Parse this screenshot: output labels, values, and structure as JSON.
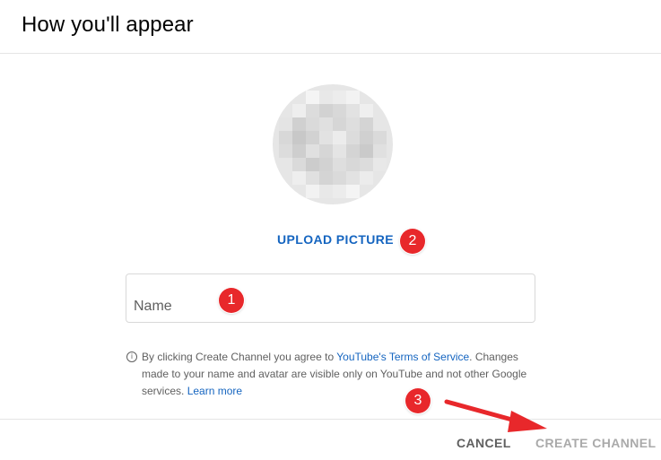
{
  "dialog": {
    "title": "How you'll appear"
  },
  "avatar": {
    "pixels": [
      {
        "c": "#f4f4f4",
        "r": 0,
        "col": 2
      },
      {
        "c": "#e8e8e8",
        "r": 0,
        "col": 3
      },
      {
        "c": "#ececec",
        "r": 0,
        "col": 4
      },
      {
        "c": "#f2f2f2",
        "r": 0,
        "col": 5
      },
      {
        "c": "#eeeeee",
        "r": 1,
        "col": 1
      },
      {
        "c": "#dcdcdc",
        "r": 1,
        "col": 2
      },
      {
        "c": "#d2d2d2",
        "r": 1,
        "col": 3
      },
      {
        "c": "#d8d8d8",
        "r": 1,
        "col": 4
      },
      {
        "c": "#e2e2e2",
        "r": 1,
        "col": 5
      },
      {
        "c": "#efefef",
        "r": 1,
        "col": 6
      },
      {
        "c": "#e4e4e4",
        "r": 2,
        "col": 0
      },
      {
        "c": "#d0d0d0",
        "r": 2,
        "col": 1
      },
      {
        "c": "#dadada",
        "r": 2,
        "col": 2
      },
      {
        "c": "#e0e0e0",
        "r": 2,
        "col": 3
      },
      {
        "c": "#d6d6d6",
        "r": 2,
        "col": 4
      },
      {
        "c": "#dedede",
        "r": 2,
        "col": 5
      },
      {
        "c": "#d4d4d4",
        "r": 2,
        "col": 6
      },
      {
        "c": "#e6e6e6",
        "r": 2,
        "col": 7
      },
      {
        "c": "#d8d8d8",
        "r": 3,
        "col": 0
      },
      {
        "c": "#c8c8c8",
        "r": 3,
        "col": 1
      },
      {
        "c": "#d2d2d2",
        "r": 3,
        "col": 2
      },
      {
        "c": "#e2e2e2",
        "r": 3,
        "col": 3
      },
      {
        "c": "#ececec",
        "r": 3,
        "col": 4
      },
      {
        "c": "#dcdcdc",
        "r": 3,
        "col": 5
      },
      {
        "c": "#d0d0d0",
        "r": 3,
        "col": 6
      },
      {
        "c": "#dadada",
        "r": 3,
        "col": 7
      },
      {
        "c": "#dcdcdc",
        "r": 4,
        "col": 0
      },
      {
        "c": "#cecece",
        "r": 4,
        "col": 1
      },
      {
        "c": "#e0e0e0",
        "r": 4,
        "col": 2
      },
      {
        "c": "#d6d6d6",
        "r": 4,
        "col": 3
      },
      {
        "c": "#e4e4e4",
        "r": 4,
        "col": 4
      },
      {
        "c": "#d4d4d4",
        "r": 4,
        "col": 5
      },
      {
        "c": "#cacaca",
        "r": 4,
        "col": 6
      },
      {
        "c": "#e0e0e0",
        "r": 4,
        "col": 7
      },
      {
        "c": "#e6e6e6",
        "r": 5,
        "col": 0
      },
      {
        "c": "#dadada",
        "r": 5,
        "col": 1
      },
      {
        "c": "#cccccc",
        "r": 5,
        "col": 2
      },
      {
        "c": "#d2d2d2",
        "r": 5,
        "col": 3
      },
      {
        "c": "#dedede",
        "r": 5,
        "col": 4
      },
      {
        "c": "#d8d8d8",
        "r": 5,
        "col": 5
      },
      {
        "c": "#dcdcdc",
        "r": 5,
        "col": 6
      },
      {
        "c": "#e8e8e8",
        "r": 5,
        "col": 7
      },
      {
        "c": "#eeeeee",
        "r": 6,
        "col": 1
      },
      {
        "c": "#e0e0e0",
        "r": 6,
        "col": 2
      },
      {
        "c": "#d4d4d4",
        "r": 6,
        "col": 3
      },
      {
        "c": "#dadada",
        "r": 6,
        "col": 4
      },
      {
        "c": "#e2e2e2",
        "r": 6,
        "col": 5
      },
      {
        "c": "#ececec",
        "r": 6,
        "col": 6
      },
      {
        "c": "#f2f2f2",
        "r": 7,
        "col": 2
      },
      {
        "c": "#e8e8e8",
        "r": 7,
        "col": 3
      },
      {
        "c": "#ececec",
        "r": 7,
        "col": 4
      },
      {
        "c": "#f4f4f4",
        "r": 7,
        "col": 5
      }
    ]
  },
  "upload": {
    "label": "UPLOAD PICTURE"
  },
  "name_field": {
    "placeholder": "Name",
    "value": ""
  },
  "terms": {
    "text_before": "By clicking Create Channel you agree to ",
    "tos_link": "YouTube's Terms of Service",
    "text_after": ". Changes made to your name and avatar are visible only on YouTube and not other Google services. ",
    "learn_more": "Learn more"
  },
  "actions": {
    "cancel_label": "CANCEL",
    "create_label": "CREATE CHANNEL"
  },
  "annotations": {
    "badge_1": "1",
    "badge_2": "2",
    "badge_3": "3"
  },
  "colors": {
    "link_blue": "#1565c0",
    "badge_red": "#e8282b",
    "disabled_gray": "#aaaaaa"
  }
}
